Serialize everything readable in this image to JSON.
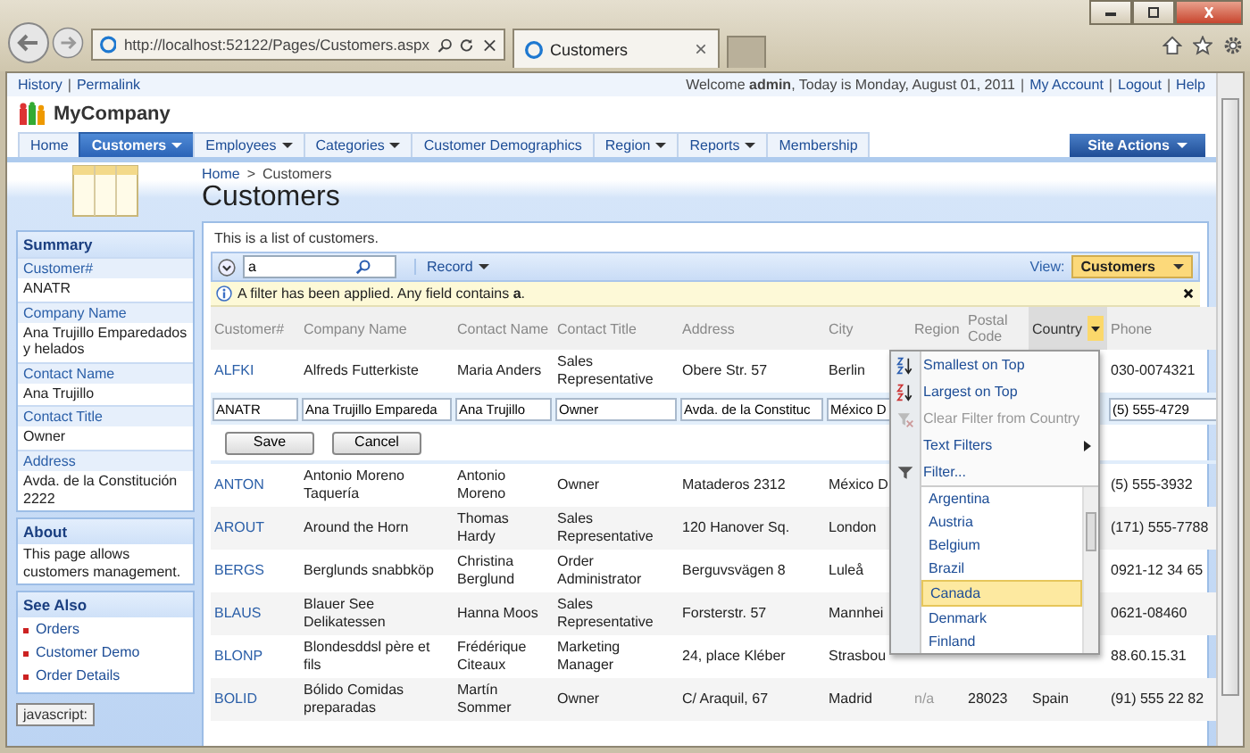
{
  "browser": {
    "address": "http://localhost:52122/Pages/Customers.aspx",
    "tab": "Customers"
  },
  "top_links": [
    {
      "kind": "link",
      "text": "History"
    },
    {
      "kind": "separator",
      "text": "|"
    },
    {
      "kind": "link",
      "text": "Permalink"
    }
  ],
  "welcome": {
    "text": "Welcome **admin**, Today is Monday, August 01, 2011",
    "links": [
      {
        "kind": "separator",
        "text": "|"
      },
      {
        "kind": "link",
        "text": "My Account"
      },
      {
        "kind": "separator",
        "text": "|"
      },
      {
        "kind": "link",
        "text": "Logout"
      },
      {
        "kind": "separator",
        "text": "|"
      },
      {
        "kind": "link",
        "text": "Help"
      }
    ]
  },
  "logo": "MyCompany",
  "nav": [
    {
      "label": "Home",
      "selected": false,
      "dropdown": false
    },
    {
      "label": "Customers",
      "selected": true,
      "dropdown": true
    },
    {
      "label": "Employees",
      "selected": false,
      "dropdown": true
    },
    {
      "label": "Categories",
      "selected": false,
      "dropdown": true
    },
    {
      "label": "Customer Demographics",
      "selected": false,
      "dropdown": false
    },
    {
      "label": "Region",
      "selected": false,
      "dropdown": true
    },
    {
      "label": "Reports",
      "selected": false,
      "dropdown": true
    },
    {
      "label": "Membership",
      "selected": false,
      "dropdown": false
    }
  ],
  "site_actions": "Site Actions",
  "breadcrumb": [
    {
      "kind": "link",
      "text": "Home"
    },
    {
      "kind": "separator",
      "text": ">"
    },
    {
      "kind": "current",
      "text": "Customers"
    }
  ],
  "title": "Customers",
  "sidebar": {
    "summary": {
      "title": "Summary",
      "fields": [
        {
          "label": "Customer#",
          "value": "ANATR"
        },
        {
          "label": "Company Name",
          "value": "Ana Trujillo Emparedados y helados"
        },
        {
          "label": "Contact Name",
          "value": "Ana Trujillo"
        },
        {
          "label": "Contact Title",
          "value": "Owner"
        },
        {
          "label": "Address",
          "value": "Avda. de la Constitución 2222"
        }
      ]
    },
    "about": {
      "title": "About",
      "text": "This page allows customers management."
    },
    "see_also": {
      "title": "See Also",
      "links": [
        "Orders",
        "Customer Demo",
        "Order Details"
      ]
    }
  },
  "grid": {
    "description": "This is a list of customers.",
    "search": {
      "value": "a"
    },
    "record_menu": "Record",
    "view_label": "View:",
    "view": "Customers",
    "filter_message": "A filter has been applied. Any field contains **a**.",
    "columns": [
      {
        "label": "Customer#",
        "active": false
      },
      {
        "label": "Company Name",
        "active": false
      },
      {
        "label": "Contact Name",
        "active": false
      },
      {
        "label": "Contact Title",
        "active": false
      },
      {
        "label": "Address",
        "active": false
      },
      {
        "label": "City",
        "active": false
      },
      {
        "label": "Region",
        "active": false
      },
      {
        "label": "Postal Code",
        "active": false
      },
      {
        "label": "Country",
        "active": true
      },
      {
        "label": "Phone",
        "active": false
      }
    ],
    "rows": [
      {
        "kind": "data",
        "id": "ALFKI",
        "company": "Alfreds Futterkiste",
        "contact": "Maria Anders",
        "title": "Sales Representative",
        "address": "Obere Str. 57",
        "city": "Berlin",
        "phone": "030-0074321"
      },
      {
        "kind": "edit",
        "id": "ANATR",
        "company": "Ana Trujillo Empareda",
        "contact": "Ana Trujillo",
        "title": "Owner",
        "address": "Avda. de la Constituc",
        "city": "México D",
        "phone": "(5) 555-4729"
      },
      {
        "kind": "data",
        "id": "ANTON",
        "company": "Antonio Moreno Taquería",
        "contact": "Antonio Moreno",
        "title": "Owner",
        "address": "Mataderos 2312",
        "city": "México D",
        "phone": "(5) 555-3932"
      },
      {
        "kind": "data",
        "id": "AROUT",
        "company": "Around the Horn",
        "contact": "Thomas Hardy",
        "title": "Sales Representative",
        "address": "120 Hanover Sq.",
        "city": "London",
        "phone": "(171) 555-7788"
      },
      {
        "kind": "data",
        "id": "BERGS",
        "company": "Berglunds snabbköp",
        "contact": "Christina Berglund",
        "title": "Order Administrator",
        "address": "Berguvsvägen 8",
        "city": "Luleå",
        "phone": "0921-12 34 65"
      },
      {
        "kind": "data",
        "id": "BLAUS",
        "company": "Blauer See Delikatessen",
        "contact": "Hanna Moos",
        "title": "Sales Representative",
        "address": "Forsterstr. 57",
        "city": "Mannhei",
        "phone": "0621-08460"
      },
      {
        "kind": "data",
        "id": "BLONP",
        "company": "Blondesddsl père et fils",
        "contact": "Frédérique Citeaux",
        "title": "Marketing Manager",
        "address": "24, place Kléber",
        "city": "Strasbou",
        "phone": "88.60.15.31"
      },
      {
        "kind": "data",
        "id": "BOLID",
        "company": "Bólido Comidas preparadas",
        "contact": "Martín Sommer",
        "title": "Owner",
        "address": "C/ Araquil, 67",
        "city": "Madrid",
        "region": "n/a",
        "postal": "28023",
        "country": "Spain",
        "phone": "(91) 555 22 82"
      }
    ],
    "buttons": [
      "Save",
      "Cancel"
    ]
  },
  "menu": {
    "items": [
      {
        "kind": "sort-asc",
        "label": "Smallest on Top",
        "disabled": false
      },
      {
        "kind": "sort-desc",
        "label": "Largest on Top",
        "disabled": false
      },
      {
        "kind": "clear",
        "label": "Clear Filter from Country",
        "disabled": true
      },
      {
        "kind": "submenu",
        "label": "Text Filters",
        "disabled": false
      },
      {
        "kind": "filter",
        "label": "Filter...",
        "disabled": false
      }
    ],
    "countries": [
      {
        "label": "Argentina",
        "selected": false
      },
      {
        "label": "Austria",
        "selected": false
      },
      {
        "label": "Belgium",
        "selected": false
      },
      {
        "label": "Brazil",
        "selected": false
      },
      {
        "label": "Canada",
        "selected": true
      },
      {
        "label": "Denmark",
        "selected": false
      },
      {
        "label": "Finland",
        "selected": false
      }
    ]
  },
  "status_tip": "javascript:"
}
